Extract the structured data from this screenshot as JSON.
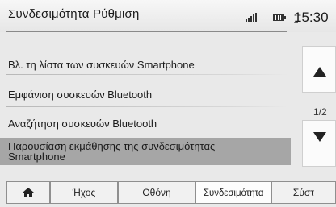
{
  "header": {
    "title": "Συνδεσιμότητα Ρύθμιση",
    "net_status": "--ᵀ",
    "clock": "15:30"
  },
  "list": {
    "items": [
      {
        "label": "Βλ. τη λίστα των συσκευών Smartphone",
        "selected": false
      },
      {
        "label": "Εμφάνιση συσκευών Bluetooth",
        "selected": false
      },
      {
        "label": "Αναζήτηση συσκευών Bluetooth",
        "selected": false
      },
      {
        "label_line1": "Παρουσίαση εκμάθησης της συνδεσιμότητας",
        "label_line2": "Smartphone",
        "selected": true
      }
    ]
  },
  "scroll": {
    "page": "1/2"
  },
  "tabs": [
    {
      "icon": "home-icon"
    },
    {
      "label": "Ήχος"
    },
    {
      "label": "Οθόνη"
    },
    {
      "label": "Συνδεσιμότητα",
      "active": true
    },
    {
      "label": "Σύστ"
    }
  ],
  "colors": {
    "background": "#e9e9e9",
    "selected_row": "#a6a6a6"
  }
}
